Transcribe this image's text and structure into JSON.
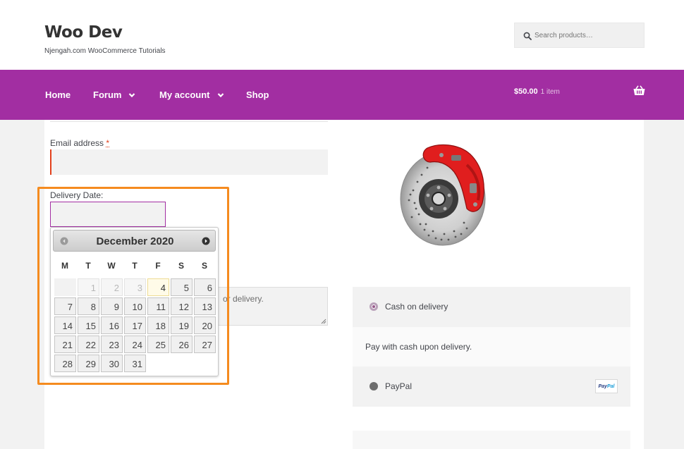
{
  "header": {
    "site_title": "Woo Dev",
    "tagline": "Njengah.com WooCommerce Tutorials",
    "search_placeholder": "Search products…"
  },
  "nav": {
    "items": [
      {
        "label": "Home",
        "has_dropdown": false
      },
      {
        "label": "Forum",
        "has_dropdown": true
      },
      {
        "label": "My account",
        "has_dropdown": true
      },
      {
        "label": "Shop",
        "has_dropdown": false
      }
    ],
    "cart_total": "$50.00",
    "cart_count": "1 item",
    "cart_icon": "basket-icon"
  },
  "form": {
    "email_label": "Email address",
    "required_mark": "*",
    "delivery_label": "Delivery Date:",
    "notes_text": "or delivery."
  },
  "datepicker": {
    "month_title": "December 2020",
    "prev_icon": "circle-arrow-left-icon",
    "next_icon": "circle-arrow-right-icon",
    "weekdays": [
      "M",
      "T",
      "W",
      "T",
      "F",
      "S",
      "S"
    ],
    "weeks": [
      [
        "",
        "1",
        "2",
        "3",
        "4",
        "5",
        "6"
      ],
      [
        "7",
        "8",
        "9",
        "10",
        "11",
        "12",
        "13"
      ],
      [
        "14",
        "15",
        "16",
        "17",
        "18",
        "19",
        "20"
      ],
      [
        "21",
        "22",
        "23",
        "24",
        "25",
        "26",
        "27"
      ],
      [
        "28",
        "29",
        "30",
        "31",
        "",
        "",
        ""
      ]
    ],
    "disabled_days": [
      "1",
      "2",
      "3"
    ],
    "today": "4"
  },
  "payment": {
    "cod_label": "Cash on delivery",
    "cod_selected": true,
    "cod_description": "Pay with cash upon delivery.",
    "paypal_label": "PayPal",
    "paypal_logo_pay": "Pay",
    "paypal_logo_pal": "Pal"
  },
  "colors": {
    "accent": "#a22ea2",
    "highlight": "#f58b1f",
    "required": "#e2401c",
    "radio_checked": "#96588a"
  }
}
